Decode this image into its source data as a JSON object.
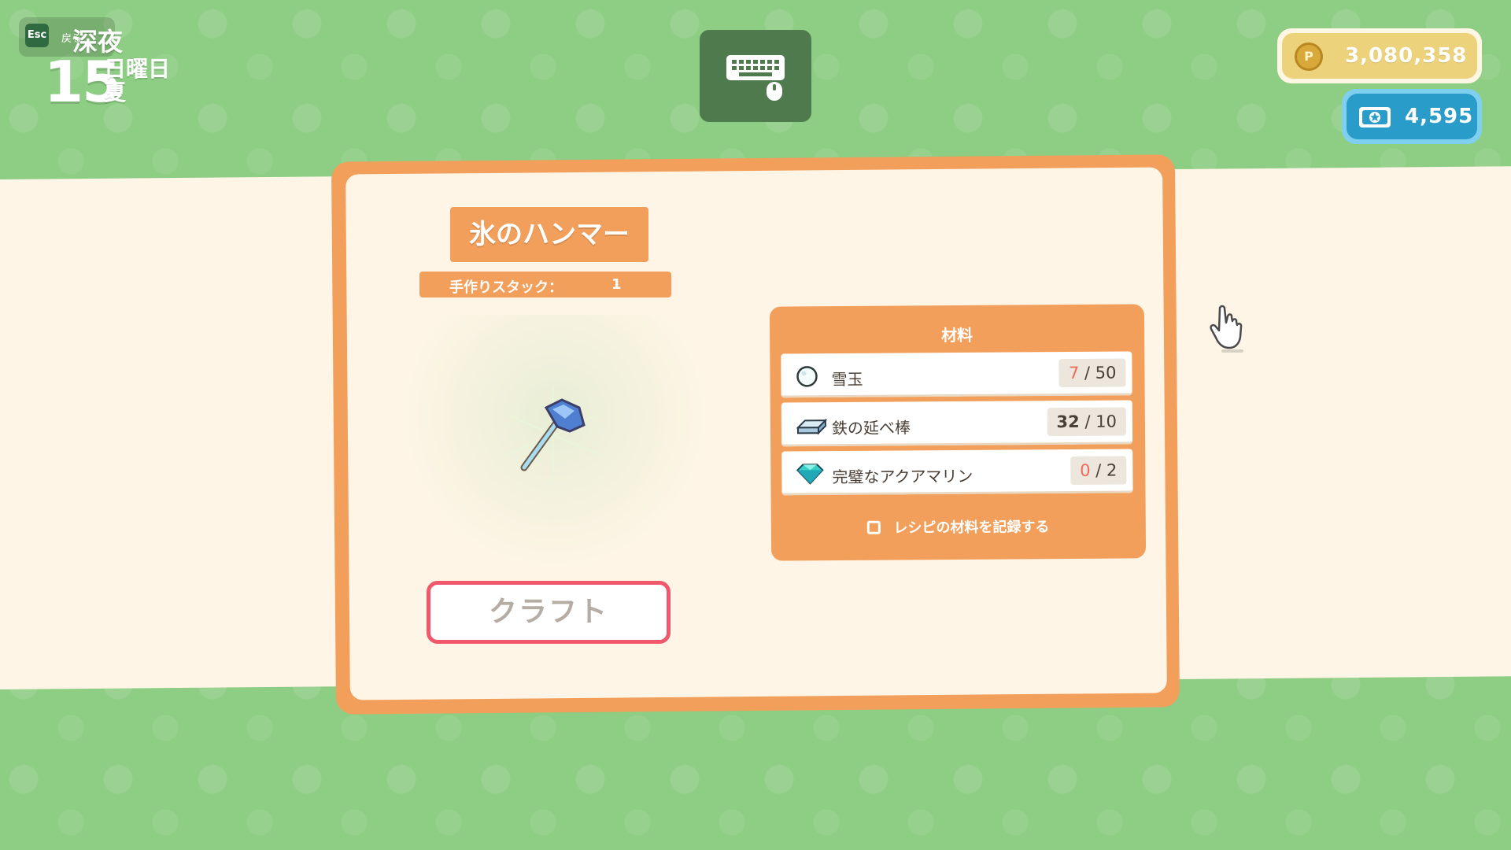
{
  "hud": {
    "esc_key": "Esc",
    "back_label": "戻る",
    "period": "深夜",
    "day": "15",
    "weekday": "日曜日",
    "season": "夏"
  },
  "currency": {
    "gold": "3,080,358",
    "tickets": "4,595"
  },
  "recipe": {
    "title": "氷のハンマー",
    "stack_label": "手作りスタック：",
    "stack_value": "1",
    "craft_label": "クラフト"
  },
  "materials": {
    "title": "材料",
    "items": [
      {
        "name": "雪玉",
        "have": "7",
        "sep": "/",
        "need": "50",
        "icon": "snowball-icon"
      },
      {
        "name": "鉄の延べ棒",
        "have": "32",
        "sep": "/",
        "need": "10",
        "icon": "iron-bar-icon"
      },
      {
        "name": "完璧なアクアマリン",
        "have": "0",
        "sep": "/",
        "need": "2",
        "icon": "aquamarine-icon"
      }
    ],
    "record_label": "レシピの材料を記録する"
  },
  "colors": {
    "background": "#8ecd84",
    "panel": "#f29f5b",
    "cream": "#fef5e6",
    "craft_border": "#f0586b",
    "insufficient": "#ef6a5a",
    "gold": "#ecd27b",
    "ticket": "#2a9cc9"
  }
}
